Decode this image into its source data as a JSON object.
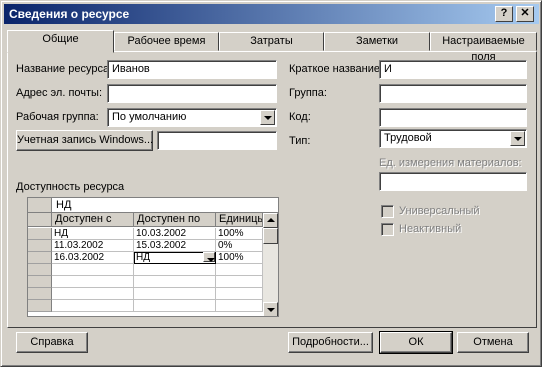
{
  "window": {
    "title": "Сведения о ресурсе",
    "help_glyph": "?",
    "close_glyph": "✕"
  },
  "tabs": [
    {
      "label": "Общие",
      "active": true
    },
    {
      "label": "Рабочее время",
      "active": false
    },
    {
      "label": "Затраты",
      "active": false
    },
    {
      "label": "Заметки",
      "active": false
    },
    {
      "label": "Настраиваемые поля",
      "active": false
    }
  ],
  "general": {
    "resource_name_label": "Название ресурса:",
    "resource_name_value": "Иванов",
    "email_label": "Адрес эл. почты:",
    "email_value": "",
    "workgroup_label": "Рабочая группа:",
    "workgroup_value": "По умолчанию",
    "windows_account_button": "Учетная запись Windows...",
    "windows_account_value": "",
    "initials_label": "Краткое название:",
    "initials_value": "И",
    "group_label": "Группа:",
    "group_value": "",
    "code_label": "Код:",
    "code_value": "",
    "type_label": "Тип:",
    "type_value": "Трудовой",
    "material_label": "Ед. измерения материалов:",
    "material_value": "",
    "generic_label": "Универсальный",
    "generic_checked": false,
    "inactive_label": "Неактивный",
    "inactive_checked": false
  },
  "availability": {
    "section_label": "Доступность ресурса",
    "edit_value": "НД",
    "columns": [
      "Доступен с",
      "Доступен по",
      "Единицы"
    ],
    "rows": [
      [
        "НД",
        "10.03.2002",
        "100%"
      ],
      [
        "11.03.2002",
        "15.03.2002",
        "0%"
      ],
      [
        "16.03.2002",
        "НД",
        "100%"
      ]
    ]
  },
  "footer": {
    "help_button": "Справка",
    "details_button": "Подробности...",
    "ok_button": "ОК",
    "cancel_button": "Отмена"
  },
  "colors": {
    "title_start": "#0a246a",
    "title_end": "#a6caf0",
    "face": "#d4d0c8"
  }
}
